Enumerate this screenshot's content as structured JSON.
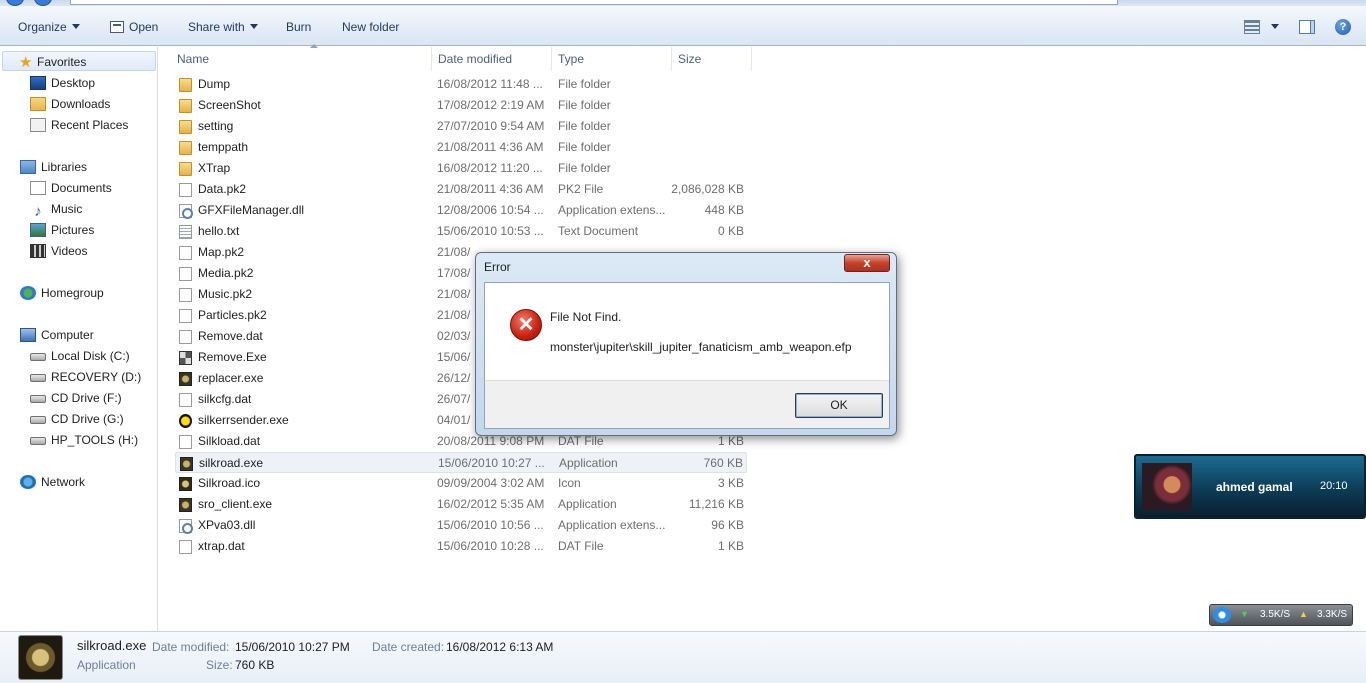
{
  "toolbar": {
    "organize": "Organize",
    "open": "Open",
    "share_with": "Share with",
    "burn": "Burn",
    "new_folder": "New folder",
    "help": "?"
  },
  "nav": {
    "favorites": "Favorites",
    "desktop": "Desktop",
    "downloads": "Downloads",
    "recent_places": "Recent Places",
    "libraries": "Libraries",
    "documents": "Documents",
    "music": "Music",
    "pictures": "Pictures",
    "videos": "Videos",
    "homegroup": "Homegroup",
    "computer": "Computer",
    "local_disk": "Local Disk (C:)",
    "recovery": "RECOVERY (D:)",
    "cd_f": "CD Drive (F:)",
    "cd_g": "CD Drive (G:)",
    "hp_tools": "HP_TOOLS (H:)",
    "network": "Network"
  },
  "columns": {
    "name": "Name",
    "date": "Date modified",
    "type": "Type",
    "size": "Size"
  },
  "files": [
    {
      "name": "Dump",
      "date": "16/08/2012 11:48 ...",
      "type": "File folder",
      "size": "",
      "icon": "folder-icon"
    },
    {
      "name": "ScreenShot",
      "date": "17/08/2012 2:19 AM",
      "type": "File folder",
      "size": "",
      "icon": "folder-icon"
    },
    {
      "name": "setting",
      "date": "27/07/2010 9:54 AM",
      "type": "File folder",
      "size": "",
      "icon": "folder-icon"
    },
    {
      "name": "temppath",
      "date": "21/08/2011 4:36 AM",
      "type": "File folder",
      "size": "",
      "icon": "folder-icon"
    },
    {
      "name": "XTrap",
      "date": "16/08/2012 11:20 ...",
      "type": "File folder",
      "size": "",
      "icon": "folder-icon"
    },
    {
      "name": "Data.pk2",
      "date": "21/08/2011 4:36 AM",
      "type": "PK2 File",
      "size": "2,086,028 KB",
      "icon": "file-icon"
    },
    {
      "name": "GFXFileManager.dll",
      "date": "12/08/2006 10:54 ...",
      "type": "Application extens...",
      "size": "448 KB",
      "icon": "dll-icon"
    },
    {
      "name": "hello.txt",
      "date": "15/06/2010 10:53 ...",
      "type": "Text Document",
      "size": "0 KB",
      "icon": "text-file-icon"
    },
    {
      "name": "Map.pk2",
      "date": "21/08/",
      "type": "",
      "size": "",
      "icon": "file-icon"
    },
    {
      "name": "Media.pk2",
      "date": "17/08/",
      "type": "",
      "size": "",
      "icon": "file-icon"
    },
    {
      "name": "Music.pk2",
      "date": "21/08/",
      "type": "",
      "size": "",
      "icon": "file-icon"
    },
    {
      "name": "Particles.pk2",
      "date": "21/08/",
      "type": "",
      "size": "",
      "icon": "file-icon"
    },
    {
      "name": "Remove.dat",
      "date": "02/03/",
      "type": "",
      "size": "",
      "icon": "file-icon"
    },
    {
      "name": "Remove.Exe",
      "date": "15/06/",
      "type": "",
      "size": "",
      "icon": "setup-exe-icon"
    },
    {
      "name": "replacer.exe",
      "date": "26/12/",
      "type": "",
      "size": "",
      "icon": "silkroad-exe-icon"
    },
    {
      "name": "silkcfg.dat",
      "date": "26/07/",
      "type": "",
      "size": "",
      "icon": "file-icon"
    },
    {
      "name": "silkerrsender.exe",
      "date": "04/01/",
      "type": "",
      "size": "",
      "icon": "error-sender-icon"
    },
    {
      "name": "Silkload.dat",
      "date": "20/08/2011 9:08 PM",
      "type": "DAT File",
      "size": "1 KB",
      "icon": "file-icon"
    },
    {
      "name": "silkroad.exe",
      "date": "15/06/2010 10:27 ...",
      "type": "Application",
      "size": "760 KB",
      "icon": "silkroad-exe-icon",
      "selected": true
    },
    {
      "name": "Silkroad.ico",
      "date": "09/09/2004 3:02 AM",
      "type": "Icon",
      "size": "3 KB",
      "icon": "silkroad-ico-icon"
    },
    {
      "name": "sro_client.exe",
      "date": "16/02/2012 5:35 AM",
      "type": "Application",
      "size": "11,216 KB",
      "icon": "silkroad-exe-icon"
    },
    {
      "name": "XPva03.dll",
      "date": "15/06/2010 10:56 ...",
      "type": "Application extens...",
      "size": "96 KB",
      "icon": "dll-icon"
    },
    {
      "name": "xtrap.dat",
      "date": "15/06/2010 10:28 ...",
      "type": "DAT File",
      "size": "1 KB",
      "icon": "file-icon"
    }
  ],
  "details": {
    "name": "silkroad.exe",
    "type": "Application",
    "date_modified_label": "Date modified:",
    "date_modified": "15/06/2010 10:27 PM",
    "size_label": "Size:",
    "size": "760 KB",
    "date_created_label": "Date created:",
    "date_created": "16/08/2012 6:13 AM"
  },
  "dialog": {
    "title": "Error",
    "close": "x",
    "line1": "File Not Find.",
    "line2": "monster\\jupiter\\skill_jupiter_fanaticism_amb_weapon.efp",
    "ok": "OK"
  },
  "notification": {
    "name": "ahmed gamal",
    "time": "20:10"
  },
  "netmeter": {
    "download": "3.5K/S",
    "upload": "3.3K/S"
  }
}
